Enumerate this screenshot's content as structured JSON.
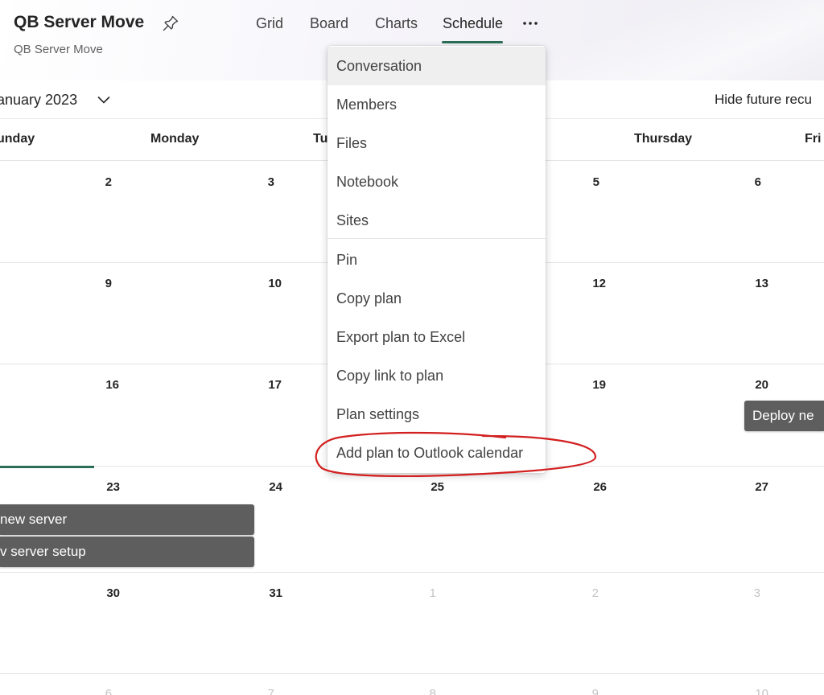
{
  "header": {
    "plan_title": "QB Server Move",
    "plan_subtitle": "QB Server Move",
    "tabs": [
      {
        "label": "Grid"
      },
      {
        "label": "Board"
      },
      {
        "label": "Charts"
      },
      {
        "label": "Schedule",
        "active": true
      }
    ],
    "more_icon": "more-horizontal-icon",
    "pin_icon": "pin-icon"
  },
  "toolbar": {
    "month_label": "anuary 2023",
    "hide_recurrences": "Hide future recu"
  },
  "calendar": {
    "day_headers": [
      "unday",
      "Monday",
      "Tu",
      "Thursday",
      "Fri"
    ],
    "weeks": [
      [
        "2",
        "3",
        "5",
        "6"
      ],
      [
        "9",
        "10",
        "12",
        "13"
      ],
      [
        "16",
        "17",
        "19",
        "20"
      ],
      [
        "23",
        "24",
        "25",
        "26",
        "27"
      ],
      [
        "30",
        "31",
        "1",
        "2",
        "3"
      ],
      [
        "6",
        "7",
        "8",
        "9",
        "10"
      ]
    ],
    "tasks": [
      {
        "label": "Deploy ne"
      },
      {
        "label": "new server"
      },
      {
        "label": "v server setup"
      }
    ]
  },
  "menu": {
    "items": [
      {
        "label": "Conversation"
      },
      {
        "label": "Members"
      },
      {
        "label": "Files"
      },
      {
        "label": "Notebook"
      },
      {
        "label": "Sites"
      },
      {
        "label": "Pin"
      },
      {
        "label": "Copy plan"
      },
      {
        "label": "Export plan to Excel"
      },
      {
        "label": "Copy link to plan"
      },
      {
        "label": "Plan settings"
      },
      {
        "label": "Add plan to Outlook calendar"
      }
    ]
  },
  "colors": {
    "accent": "#2b6e55",
    "task_bg": "#5f5e5e",
    "annotation": "#d21f1f"
  }
}
